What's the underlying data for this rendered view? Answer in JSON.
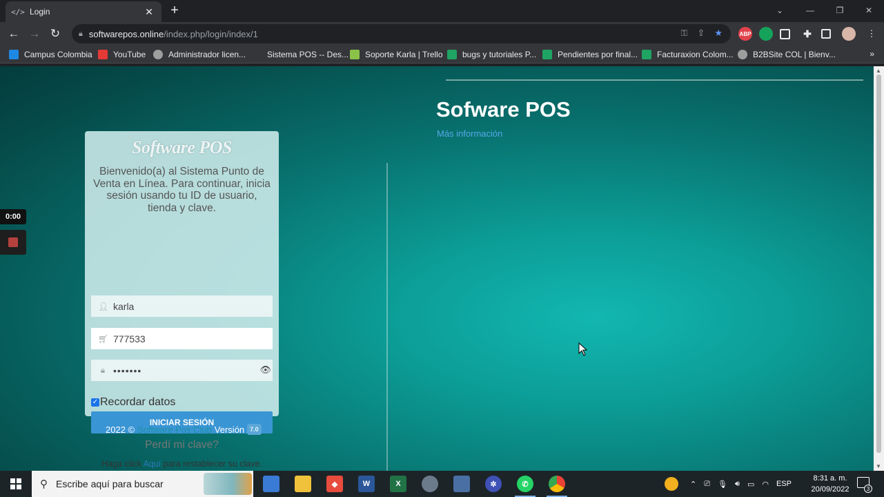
{
  "browser": {
    "tab_title": "Login",
    "tab_icon": "code-icon",
    "url_host": "softwarepos.online",
    "url_path": "/index.php/login/index/1",
    "bookmarks": [
      {
        "label": "Campus Colombia",
        "color": "#1e88e5"
      },
      {
        "label": "YouTube",
        "color": "#e53935"
      },
      {
        "label": "Administrador licen...",
        "color": "#9e9e9e"
      },
      {
        "label": "Sistema POS -- Des...",
        "color": "#35363a"
      },
      {
        "label": "Soporte Karla | Trello",
        "color": "#8bc34a"
      },
      {
        "label": "bugs y tutoriales P...",
        "color": "#1fa463"
      },
      {
        "label": "Pendientes por final...",
        "color": "#1fa463"
      },
      {
        "label": "Facturaxion Colom...",
        "color": "#1fa463"
      },
      {
        "label": "B2BSite COL | Bienv...",
        "color": "#9e9e9e"
      }
    ],
    "more_bookmarks": "»",
    "ext_abp": "ABP"
  },
  "recorder": {
    "time": "0:00"
  },
  "hero": {
    "title": "Sofware POS",
    "more_link": "Más información"
  },
  "login": {
    "logo_text": "Software POS",
    "welcome": "Bienvenido(a) al Sistema Punto de Venta en Línea. Para continuar, inicia sesión usando tu ID de usuario, tienda y clave.",
    "user_value": "karla",
    "store_value": "777533",
    "password_value": "•••••••",
    "remember_label": "Recordar datos",
    "remember_checked": true,
    "submit_label": "INICIAR SESIÓN",
    "forgot_title": "Perdí mi clave?",
    "reset_prefix": "Haga click",
    "reset_link": "Aquí",
    "reset_suffix": "para restablecer su clave."
  },
  "footer": {
    "year": "2022 ©",
    "brand": "Software Pos Club",
    "version_label": "Versión",
    "version": "7.0"
  },
  "taskbar": {
    "search_placeholder": "Escribe aquí para buscar",
    "lang": "ESP",
    "time": "8:31 a. m.",
    "date": "20/09/2022",
    "notifications": "3"
  },
  "colors": {
    "accent_button": "#3a95d4",
    "page_teal": "#0c9c96"
  }
}
